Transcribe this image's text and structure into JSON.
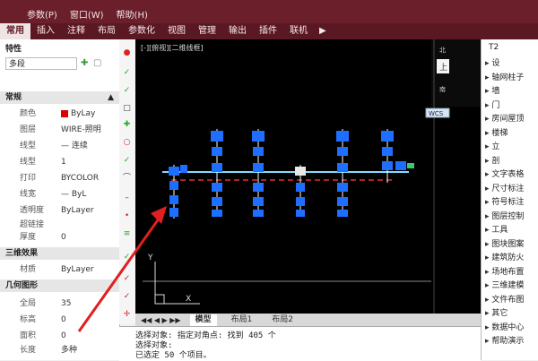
{
  "menu": {
    "items": [
      "参数(P)",
      "窗口(W)",
      "帮助(H)"
    ]
  },
  "ribbon": {
    "tabs": [
      "常用",
      "插入",
      "注释",
      "布局",
      "参数化",
      "视图",
      "管理",
      "输出",
      "插件",
      "联机"
    ],
    "active_index": 0
  },
  "properties": {
    "title": "特性",
    "selection": "多段",
    "sections": {
      "general": "常规",
      "threed": "三维效果",
      "geometry": "几何图形"
    },
    "general_rows": [
      {
        "label": "颜色",
        "value": "ByLay"
      },
      {
        "label": "图层",
        "value": "WIRE-照明"
      },
      {
        "label": "线型",
        "value": "— 连续"
      },
      {
        "label": "线型",
        "value": "1"
      },
      {
        "label": "打印",
        "value": "BYCOLOR"
      },
      {
        "label": "线宽",
        "value": "— ByL"
      },
      {
        "label": "透明度",
        "value": "ByLayer"
      },
      {
        "label": "超链接",
        "value": ""
      },
      {
        "label": "厚度",
        "value": "0"
      }
    ],
    "threed_rows": [
      {
        "label": "材质",
        "value": "ByLayer"
      }
    ],
    "geometry_rows": [
      {
        "label": "全局",
        "value": "35"
      },
      {
        "label": "标高",
        "value": "0"
      },
      {
        "label": "面积",
        "value": "0"
      },
      {
        "label": "长度",
        "value": "多种"
      }
    ],
    "color_swatch": "#e00000"
  },
  "viewport": {
    "label": "[-][俯视][二维线框]",
    "viewcube_face": "上",
    "viewcube_n": "北",
    "viewcube_s": "南",
    "wcs_label": "WCS",
    "axis_x": "X",
    "axis_y": "Y",
    "fixture_color": "#1e6fff",
    "wire_color": "#e03030",
    "main_line_color": "#7fe0ff"
  },
  "layout_tabs": [
    "模型",
    "布局1",
    "布局2"
  ],
  "command": {
    "lines": [
      "选择对象: 指定对角点: 找到 405 个",
      "选择对象:",
      "已选定 50 个项目。"
    ]
  },
  "right_panel": {
    "title": "T2",
    "items": [
      "设",
      "轴网柱子",
      "墙",
      "门",
      "房间屋顶",
      "楼梯",
      "立",
      "剖",
      "文字表格",
      "尺寸标注",
      "符号标注",
      "图层控制",
      "工具",
      "图块图案",
      "建筑防火",
      "场地布置",
      "三维建模",
      "文件布图",
      "其它",
      "数据中心",
      "帮助演示"
    ]
  }
}
